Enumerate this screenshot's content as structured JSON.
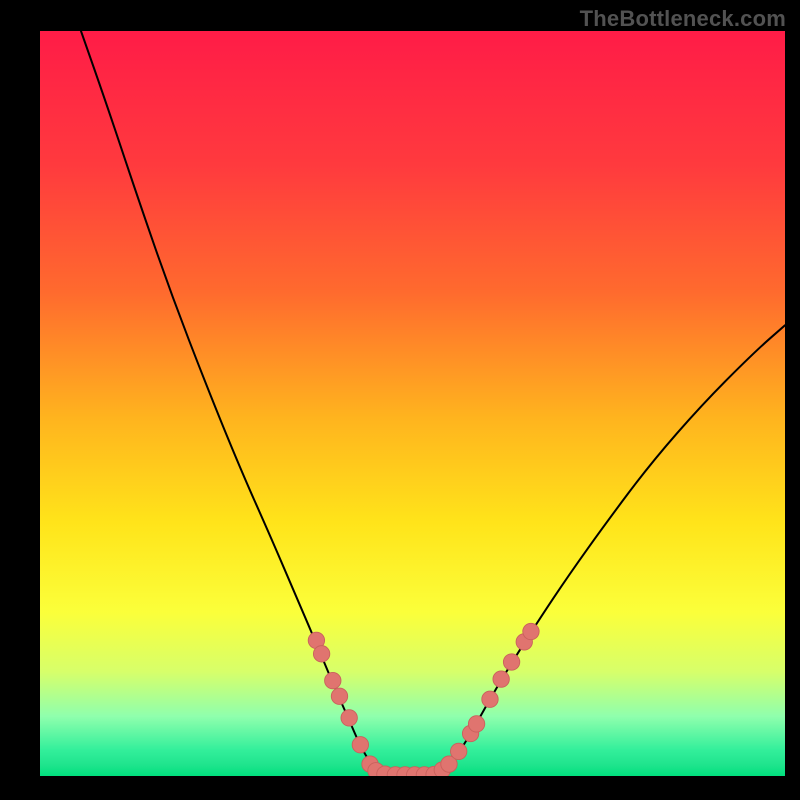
{
  "watermark": {
    "text": "TheBottleneck.com"
  },
  "colors": {
    "black": "#000000",
    "stroke": "#000000",
    "marker_fill": "#e0746f",
    "marker_stroke": "#c9615c"
  },
  "chart_data": {
    "type": "line",
    "title": "",
    "xlabel": "",
    "ylabel": "",
    "xlim": [
      0,
      100
    ],
    "ylim": [
      0,
      100
    ],
    "grid": false,
    "legend": false,
    "gradient_stops": [
      {
        "offset": 0,
        "color": "#ff1c47"
      },
      {
        "offset": 0.18,
        "color": "#ff3a3e"
      },
      {
        "offset": 0.35,
        "color": "#ff6a2e"
      },
      {
        "offset": 0.52,
        "color": "#ffb41e"
      },
      {
        "offset": 0.66,
        "color": "#ffe41a"
      },
      {
        "offset": 0.78,
        "color": "#fbff3a"
      },
      {
        "offset": 0.86,
        "color": "#d7ff6a"
      },
      {
        "offset": 0.92,
        "color": "#8fffad"
      },
      {
        "offset": 0.965,
        "color": "#33ef9b"
      },
      {
        "offset": 0.985,
        "color": "#1fe48d"
      },
      {
        "offset": 1,
        "color": "#00e07e"
      }
    ],
    "series": [
      {
        "name": "left-curve",
        "points": [
          {
            "x": 5.5,
            "y": 100.0
          },
          {
            "x": 9.0,
            "y": 90.0
          },
          {
            "x": 13.0,
            "y": 78.0
          },
          {
            "x": 17.5,
            "y": 65.0
          },
          {
            "x": 22.5,
            "y": 52.0
          },
          {
            "x": 27.0,
            "y": 41.0
          },
          {
            "x": 31.0,
            "y": 32.0
          },
          {
            "x": 34.0,
            "y": 25.0
          },
          {
            "x": 37.0,
            "y": 18.0
          },
          {
            "x": 39.5,
            "y": 12.0
          },
          {
            "x": 41.5,
            "y": 7.5
          },
          {
            "x": 43.0,
            "y": 4.0
          },
          {
            "x": 44.5,
            "y": 1.5
          },
          {
            "x": 45.5,
            "y": 0.5
          },
          {
            "x": 47.0,
            "y": 0.15
          }
        ]
      },
      {
        "name": "flat-bottom",
        "points": [
          {
            "x": 47.0,
            "y": 0.15
          },
          {
            "x": 53.0,
            "y": 0.15
          }
        ]
      },
      {
        "name": "right-curve",
        "points": [
          {
            "x": 53.0,
            "y": 0.15
          },
          {
            "x": 54.5,
            "y": 1.0
          },
          {
            "x": 56.0,
            "y": 2.8
          },
          {
            "x": 58.0,
            "y": 6.0
          },
          {
            "x": 60.5,
            "y": 10.5
          },
          {
            "x": 63.5,
            "y": 15.5
          },
          {
            "x": 67.0,
            "y": 21.0
          },
          {
            "x": 71.0,
            "y": 27.0
          },
          {
            "x": 76.0,
            "y": 34.0
          },
          {
            "x": 82.0,
            "y": 42.0
          },
          {
            "x": 89.0,
            "y": 50.0
          },
          {
            "x": 96.0,
            "y": 57.0
          },
          {
            "x": 100.0,
            "y": 60.5
          }
        ]
      }
    ],
    "markers": [
      {
        "x": 37.1,
        "y": 18.2
      },
      {
        "x": 37.8,
        "y": 16.4
      },
      {
        "x": 39.3,
        "y": 12.8
      },
      {
        "x": 40.2,
        "y": 10.7
      },
      {
        "x": 41.5,
        "y": 7.8
      },
      {
        "x": 43.0,
        "y": 4.2
      },
      {
        "x": 44.3,
        "y": 1.6
      },
      {
        "x": 45.1,
        "y": 0.7
      },
      {
        "x": 46.3,
        "y": 0.25
      },
      {
        "x": 47.7,
        "y": 0.15
      },
      {
        "x": 49.0,
        "y": 0.15
      },
      {
        "x": 50.3,
        "y": 0.15
      },
      {
        "x": 51.6,
        "y": 0.15
      },
      {
        "x": 52.9,
        "y": 0.2
      },
      {
        "x": 54.0,
        "y": 0.8
      },
      {
        "x": 54.9,
        "y": 1.6
      },
      {
        "x": 56.2,
        "y": 3.3
      },
      {
        "x": 57.8,
        "y": 5.7
      },
      {
        "x": 58.6,
        "y": 7.0
      },
      {
        "x": 60.4,
        "y": 10.3
      },
      {
        "x": 61.9,
        "y": 13.0
      },
      {
        "x": 63.3,
        "y": 15.3
      },
      {
        "x": 65.0,
        "y": 18.0
      },
      {
        "x": 65.9,
        "y": 19.4
      }
    ],
    "marker_radius": 1.1
  }
}
